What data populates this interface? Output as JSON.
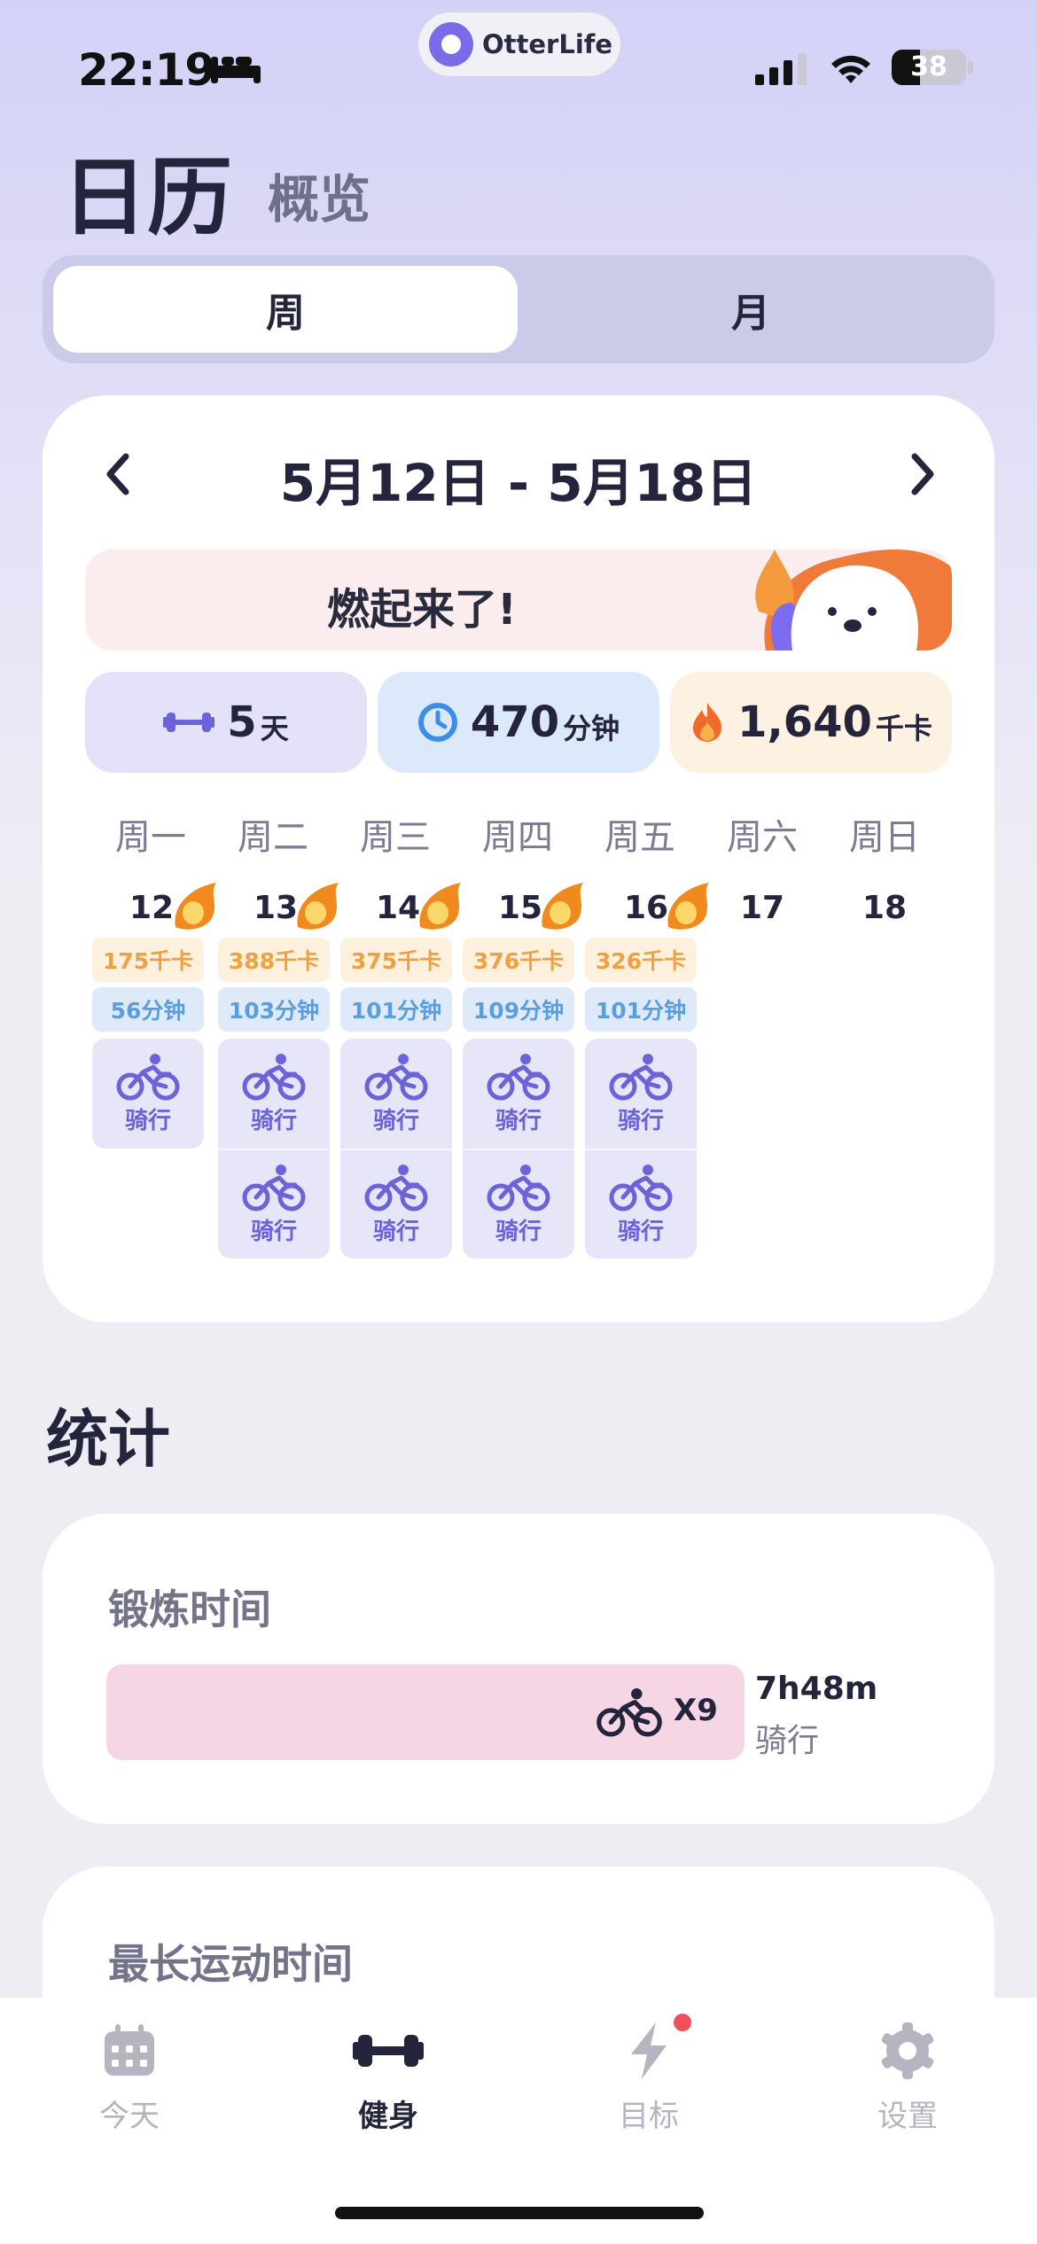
{
  "status_bar": {
    "time": "22:19",
    "battery": "38",
    "battery_level": 0.38,
    "focus_icon": "bed-icon"
  },
  "app_badge": {
    "name": "OtterLife"
  },
  "header": {
    "title": "日历",
    "subtitle": "概览"
  },
  "segmented": {
    "week": "周",
    "month": "月",
    "selected": "week"
  },
  "calendar": {
    "range": "5月12日 - 5月18日",
    "banner": "燃起来了!",
    "summary": {
      "days_value": "5",
      "days_unit": "天",
      "minutes_value": "470",
      "minutes_unit": "分钟",
      "kcal_value": "1,640",
      "kcal_unit": "千卡"
    },
    "weekdays": [
      "周一",
      "周二",
      "周三",
      "周四",
      "周五",
      "周六",
      "周日"
    ],
    "days": [
      {
        "date": "12",
        "kcal": "175千卡",
        "minutes": "56分钟",
        "activities": [
          "骑行"
        ]
      },
      {
        "date": "13",
        "kcal": "388千卡",
        "minutes": "103分钟",
        "activities": [
          "骑行",
          "骑行"
        ]
      },
      {
        "date": "14",
        "kcal": "375千卡",
        "minutes": "101分钟",
        "activities": [
          "骑行",
          "骑行"
        ]
      },
      {
        "date": "15",
        "kcal": "376千卡",
        "minutes": "109分钟",
        "activities": [
          "骑行",
          "骑行"
        ]
      },
      {
        "date": "16",
        "kcal": "326千卡",
        "minutes": "101分钟",
        "activities": [
          "骑行",
          "骑行"
        ]
      },
      {
        "date": "17"
      },
      {
        "date": "18"
      }
    ],
    "colors": {
      "accent": "#6b63d8",
      "kcal": "#f0a040",
      "minutes": "#5a9ee0"
    }
  },
  "stats": {
    "title": "统计",
    "exercise_time": {
      "title": "锻炼时间",
      "count": "X9",
      "total": "7h48m",
      "activity": "骑行"
    },
    "longest": {
      "title": "最长运动时间"
    }
  },
  "tabs": [
    {
      "label": "今天",
      "icon": "calendar-icon"
    },
    {
      "label": "健身",
      "icon": "dumbbell-icon",
      "active": true
    },
    {
      "label": "目标",
      "icon": "bolt-icon",
      "badge": true
    },
    {
      "label": "设置",
      "icon": "gear-icon"
    }
  ]
}
